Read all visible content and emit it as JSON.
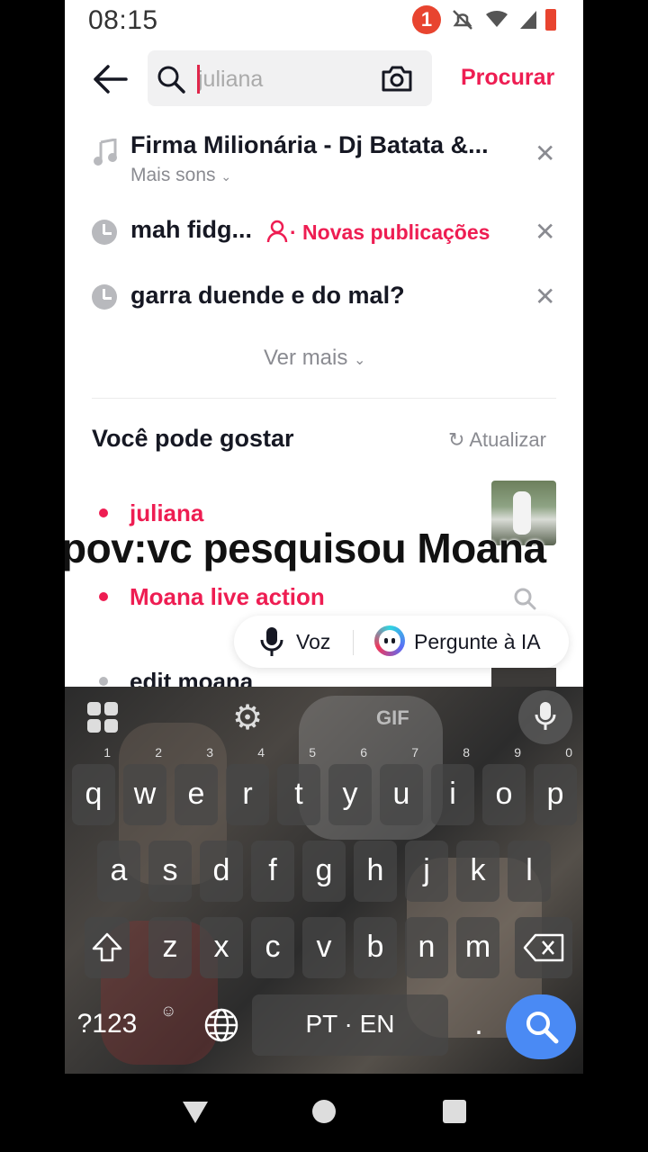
{
  "status": {
    "time": "08:15",
    "notification_count": "1"
  },
  "header": {
    "search_value": "juliana",
    "search_button": "Procurar"
  },
  "history": [
    {
      "title": "Firma Milionária - Dj Batata &...",
      "sub": "Mais sons"
    },
    {
      "title": "mah fidg...",
      "tag": "· Novas publicações"
    },
    {
      "title": "garra duende e do mal?"
    }
  ],
  "see_more": "Ver mais",
  "suggestions": {
    "title": "Você pode gostar",
    "refresh": "Atualizar",
    "items": [
      "juliana",
      "Moana live action",
      "edit moana"
    ]
  },
  "overlay_caption": "pov:vc pesquisou Moana",
  "float_bar": {
    "voice": "Voz",
    "ask_ai": "Pergunte à IA"
  },
  "keyboard": {
    "row1": [
      {
        "k": "q",
        "n": "1"
      },
      {
        "k": "w",
        "n": "2"
      },
      {
        "k": "e",
        "n": "3"
      },
      {
        "k": "r",
        "n": "4"
      },
      {
        "k": "t",
        "n": "5"
      },
      {
        "k": "y",
        "n": "6"
      },
      {
        "k": "u",
        "n": "7"
      },
      {
        "k": "i",
        "n": "8"
      },
      {
        "k": "o",
        "n": "9"
      },
      {
        "k": "p",
        "n": "0"
      }
    ],
    "row2": [
      "a",
      "s",
      "d",
      "f",
      "g",
      "h",
      "j",
      "k",
      "l"
    ],
    "row3": [
      "z",
      "x",
      "c",
      "v",
      "b",
      "n",
      "m"
    ],
    "symbols": "?123",
    "space": "PT · EN",
    "period": ".",
    "gif": "GIF"
  },
  "colors": {
    "accent": "#ee1d52",
    "search_key": "#4a8af4"
  }
}
